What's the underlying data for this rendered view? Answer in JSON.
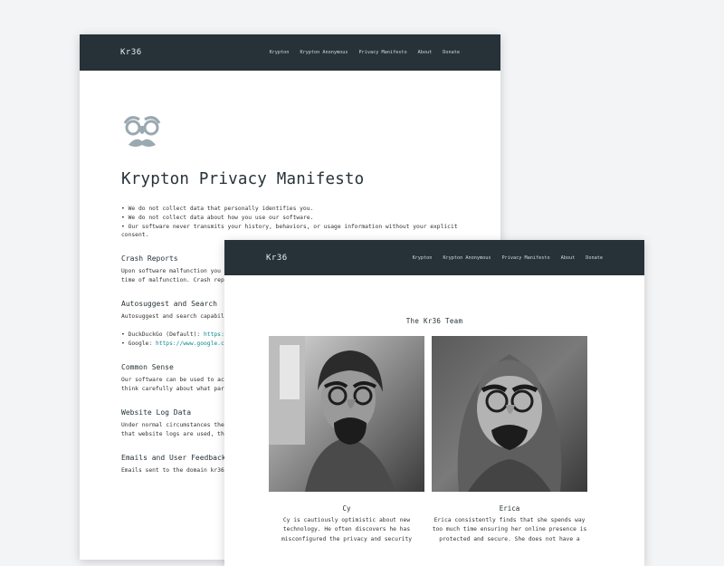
{
  "back_page": {
    "brand": "Kr36",
    "nav": [
      "Krypton",
      "Krypton Anonymous",
      "Privacy Manifesto",
      "About",
      "Donate"
    ],
    "title": "Krypton Privacy Manifesto",
    "bullets": [
      "We do not collect data that personally identifies you.",
      "We do not collect data about how you use our software.",
      "Our software never transmits your history, behaviors, or usage information without your explicit consent."
    ],
    "sections": [
      {
        "heading": "Crash Reports",
        "text": "Upon software malfunction you accept, a report will be sent details about your mobile devi time of malfunction. Crash rep them, but only if you are comf of malfunction."
      },
      {
        "heading": "Autosuggest and Search",
        "text": "Autosuggest and search capabil features is subject to the pri find those policies below:",
        "links": [
          {
            "label": "DuckDuckGo (Default):",
            "url": "https:"
          },
          {
            "label": "Google:",
            "url": "https://www.google.co"
          }
        ]
      },
      {
        "heading": "Common Sense",
        "text": "Our software can be used to ac organizations. When you choose browsing interaction may be su think carefully about what par"
      },
      {
        "heading": "Website Log Data",
        "text": "Under normal circumstances the reserve the right to temporari Website logs contain the detai that website logs are used, th"
      },
      {
        "heading": "Emails and User Feedback",
        "text": "Emails sent to the domain kr36"
      }
    ]
  },
  "front_page": {
    "brand": "Kr36",
    "nav": [
      "Krypton",
      "Krypton Anonymous",
      "Privacy Manifesto",
      "About",
      "Donate"
    ],
    "team_title": "The Kr36 Team",
    "members": [
      {
        "name": "Cy",
        "bio": "Cy is cautiously optimistic about new technology. He often discovers he has misconfigured the privacy and security"
      },
      {
        "name": "Erica",
        "bio": "Erica consistently finds that she spends way too much time ensuring her online presence is protected and secure. She does not have a"
      }
    ]
  },
  "colors": {
    "navbar": "#263238",
    "link": "#0e8a8f",
    "background": "#f3f4f6"
  }
}
